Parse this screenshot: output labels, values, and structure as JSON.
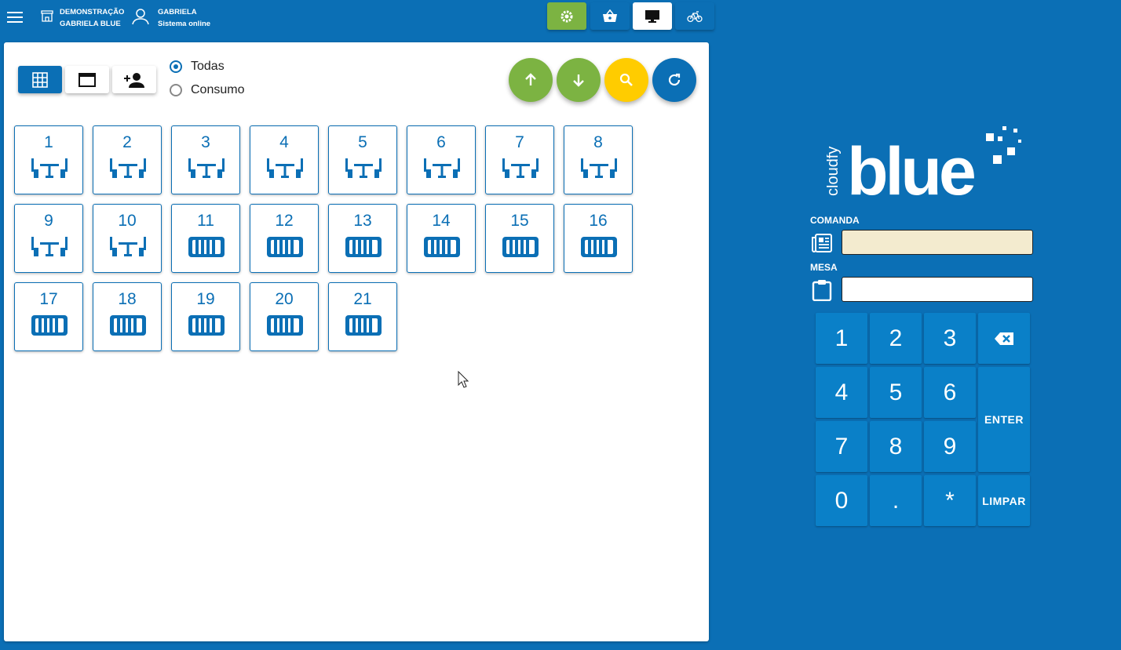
{
  "header": {
    "store_line1": "DEMONSTRAÇÃO",
    "store_line2": "GABRIELA BLUE",
    "user_name": "GABRIELA",
    "user_status": "Sistema online",
    "colors": {
      "bar": "#0b6fb5",
      "settings_btn": "#7cb342",
      "active_btn": "#ffffff"
    },
    "buttons": [
      "settings-icon",
      "basket-icon",
      "monitor-icon",
      "bicycle-icon"
    ]
  },
  "filters": {
    "view_buttons": [
      "grid-icon",
      "window-icon",
      "add-person-icon"
    ],
    "radio_all": "Todas",
    "radio_consumption": "Consumo",
    "selected": "Todas"
  },
  "actions": {
    "colors": {
      "up": "#7cb342",
      "down": "#7cb342",
      "search": "#ffcc00",
      "refresh": "#0b6fb5"
    }
  },
  "tables": [
    {
      "number": "1",
      "type": "table"
    },
    {
      "number": "2",
      "type": "table"
    },
    {
      "number": "3",
      "type": "table"
    },
    {
      "number": "4",
      "type": "table"
    },
    {
      "number": "5",
      "type": "table"
    },
    {
      "number": "6",
      "type": "table"
    },
    {
      "number": "7",
      "type": "table"
    },
    {
      "number": "8",
      "type": "table"
    },
    {
      "number": "9",
      "type": "table"
    },
    {
      "number": "10",
      "type": "table"
    },
    {
      "number": "11",
      "type": "card"
    },
    {
      "number": "12",
      "type": "card"
    },
    {
      "number": "13",
      "type": "card"
    },
    {
      "number": "14",
      "type": "card"
    },
    {
      "number": "15",
      "type": "card"
    },
    {
      "number": "16",
      "type": "card"
    },
    {
      "number": "17",
      "type": "card"
    },
    {
      "number": "18",
      "type": "card"
    },
    {
      "number": "19",
      "type": "card"
    },
    {
      "number": "20",
      "type": "card"
    },
    {
      "number": "21",
      "type": "card"
    }
  ],
  "side": {
    "logo_small": "cloudfy",
    "logo_big": "blue",
    "comanda_label": "COMANDA",
    "comanda_value": "",
    "mesa_label": "MESA",
    "mesa_value": "",
    "keys": [
      "1",
      "2",
      "3",
      "⌫",
      "4",
      "5",
      "6",
      "ENTER",
      "7",
      "8",
      "9",
      "0",
      ".",
      "*",
      "LIMPAR"
    ]
  }
}
